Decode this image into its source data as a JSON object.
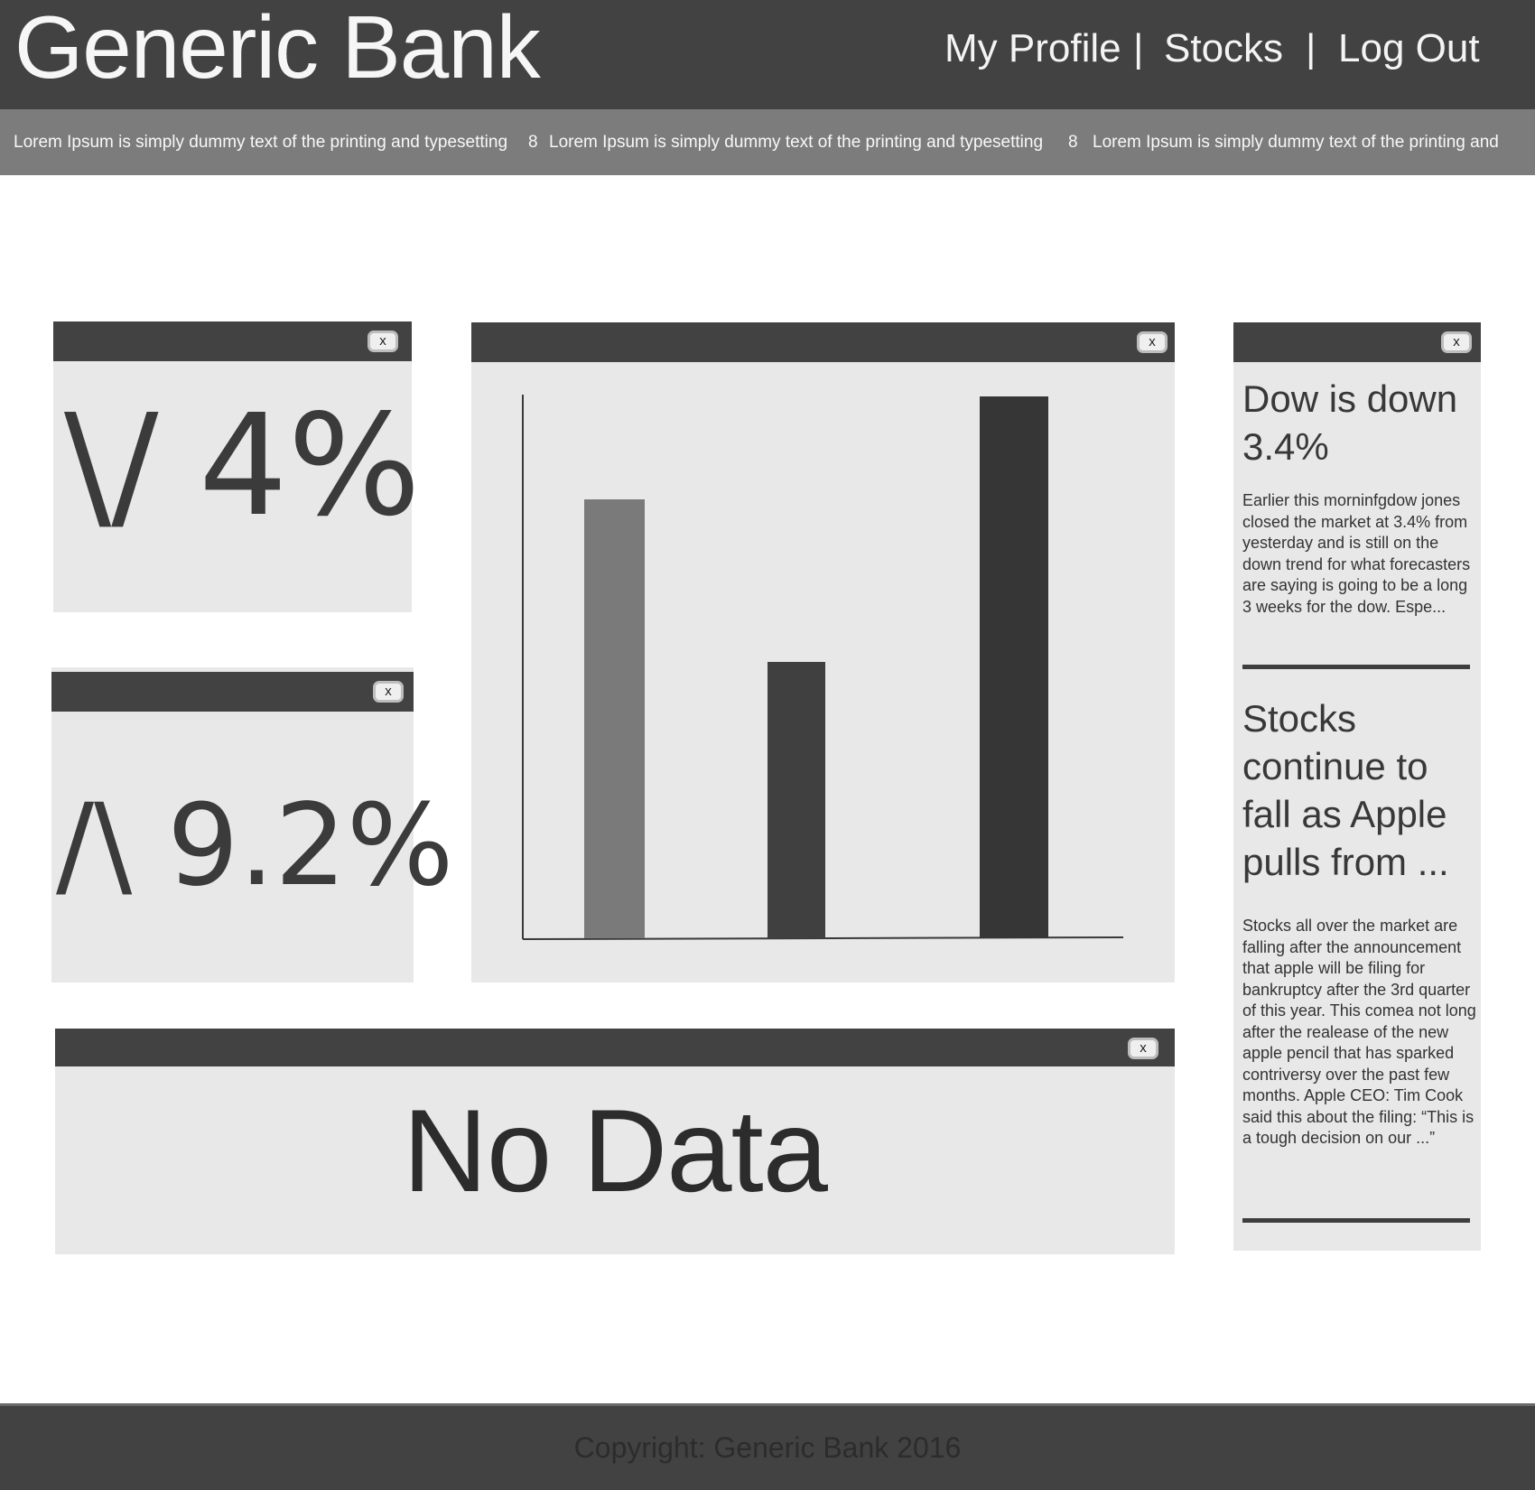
{
  "header": {
    "brand": "Generic Bank",
    "nav": {
      "my_profile": "My Profile",
      "stocks": "Stocks",
      "log_out": "Log Out",
      "separator": "|"
    }
  },
  "ticker": {
    "items": [
      "Lorem Ipsum is simply dummy text of the printing and typesetting",
      "8",
      "Lorem Ipsum is simply dummy text of the printing and typesetting",
      "8",
      "Lorem Ipsum is simply dummy text of the printing and"
    ]
  },
  "widgets": {
    "close_label": "x",
    "stat_down": {
      "arrow": "\\/",
      "value": "4%"
    },
    "stat_up": {
      "arrow": "/\\",
      "value": "9.2%"
    },
    "no_data": "No Data"
  },
  "chart_data": {
    "type": "bar",
    "categories": [
      "",
      "",
      ""
    ],
    "values": [
      81,
      51,
      100
    ],
    "colors": [
      "#7a7a7a",
      "#404040",
      "#363636"
    ],
    "ylim": [
      0,
      100
    ],
    "grid": false,
    "title": "",
    "xlabel": "",
    "ylabel": ""
  },
  "news": [
    {
      "title": "Dow is down 3.4%",
      "body": "Earlier this morninfgdow jones closed the market at 3.4% from yesterday and is still on the down trend for what forecasters are saying is going to be a long 3 weeks for the dow. Espe..."
    },
    {
      "title": "Stocks continue to fall as Apple pulls from ...",
      "body": "Stocks all over the market are falling after the announcement that apple will be filing for bankruptcy after the 3rd quarter of this year. This comea not long after the realease of the new apple pencil that has sparked contriversy over the past few months. Apple CEO: Tim Cook said this about the filing: “This is a tough decision on our ...”"
    }
  ],
  "footer": {
    "copyright": "Copyright: Generic Bank 2016"
  },
  "colors": {
    "header_bg": "#424242",
    "ticker_bg": "#7c7c7c",
    "panel_bg": "#e8e8e8"
  }
}
